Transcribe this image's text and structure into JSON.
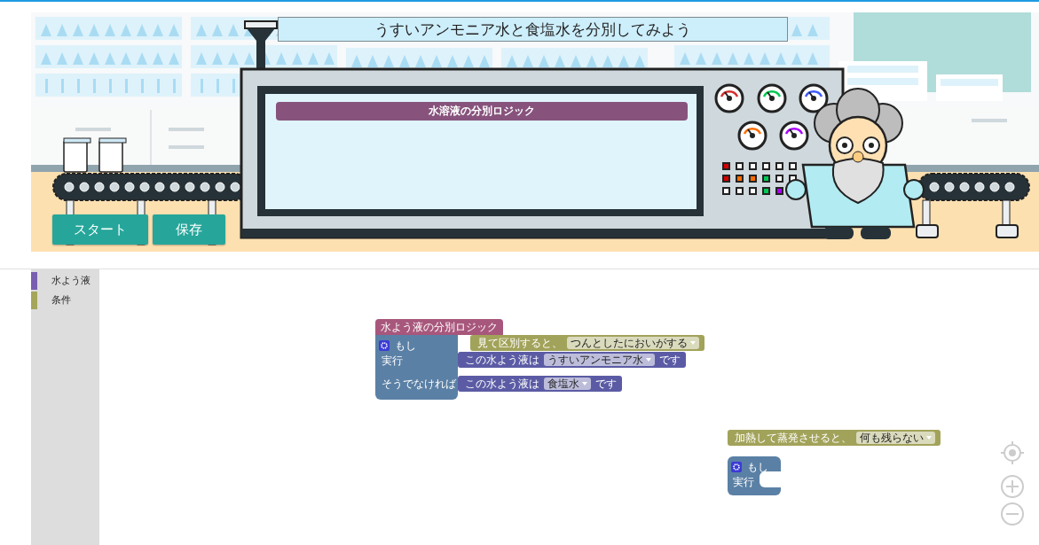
{
  "title": "うすいアンモニア水と食塩水を分別してみよう",
  "machine": {
    "screen_title": "水溶液の分別ロジック"
  },
  "buttons": [
    {
      "label": "スタート"
    },
    {
      "label": "保存"
    }
  ],
  "toolbox": {
    "categories": [
      {
        "label": "水よう液",
        "color": "#7a5fb0"
      },
      {
        "label": "条件",
        "color": "#a5a55b"
      }
    ]
  },
  "workspace": {
    "blocks": [
      {
        "kind": "procedure",
        "label": "水よう液の分別ロジック",
        "if": "もし",
        "then": "実行",
        "else": "そうでなければ"
      },
      {
        "kind": "condition",
        "text": "見て区別すると、",
        "choice": "つんとしたにおいがする"
      },
      {
        "kind": "result",
        "text": "この水よう液は",
        "choice": "うすいアンモニア水",
        "suffix": "です"
      },
      {
        "kind": "result",
        "text": "この水よう液は",
        "choice": "食塩水",
        "suffix": "です"
      },
      {
        "kind": "condition",
        "text": "加熱して蒸発させると、",
        "choice": "何も残らない"
      },
      {
        "kind": "if",
        "if": "もし",
        "then": "実行"
      }
    ]
  }
}
